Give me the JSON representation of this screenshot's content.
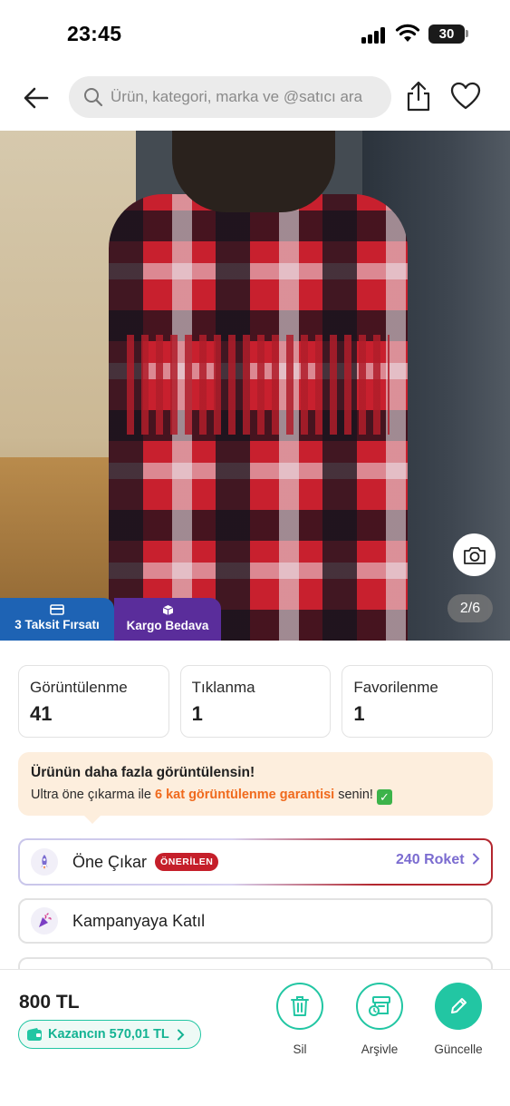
{
  "status_bar": {
    "time": "23:45",
    "battery": "30"
  },
  "search": {
    "placeholder": "Ürün, kategori, marka ve @satıcı ara"
  },
  "gallery": {
    "counter": "2/6"
  },
  "badges": {
    "installment": "3 Taksit Fırsatı",
    "shipping": "Kargo Bedava"
  },
  "stats": [
    {
      "label": "Görüntülenme",
      "value": "41"
    },
    {
      "label": "Tıklanma",
      "value": "1"
    },
    {
      "label": "Favorilenme",
      "value": "1"
    }
  ],
  "promo": {
    "title": "Ürünün daha fazla görüntülensin!",
    "text_before": "Ultra öne çıkarma ile ",
    "highlight": "6 kat görüntülenme garantisi",
    "text_after": " senin! "
  },
  "actions": {
    "boost": {
      "label": "Öne Çıkar",
      "badge": "ÖNERİLEN",
      "price": "240 Roket"
    },
    "campaign": {
      "label": "Kampanyaya Katıl"
    }
  },
  "bottom": {
    "price": "800 TL",
    "gain": "Kazancın 570,01 TL",
    "delete": "Sil",
    "archive": "Arşivle",
    "update": "Güncelle"
  },
  "colors": {
    "accent": "#22c6a3",
    "promo_orange": "#f06a1d",
    "recommended_red": "#c51f2a",
    "roket_purple": "#7b6cd0"
  }
}
